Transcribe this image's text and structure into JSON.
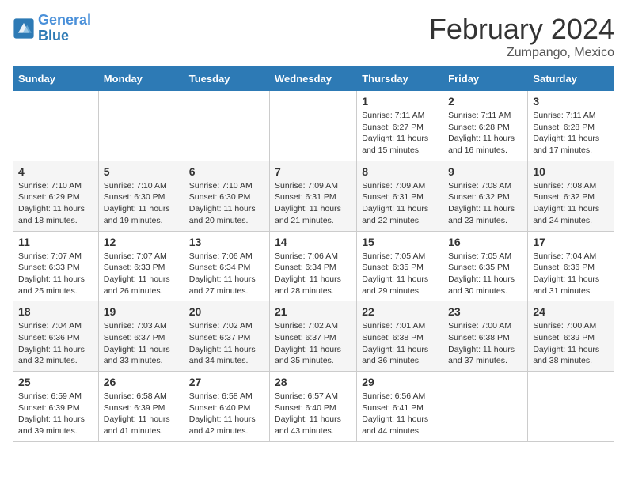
{
  "header": {
    "logo_line1": "General",
    "logo_line2": "Blue",
    "title": "February 2024",
    "subtitle": "Zumpango, Mexico"
  },
  "weekdays": [
    "Sunday",
    "Monday",
    "Tuesday",
    "Wednesday",
    "Thursday",
    "Friday",
    "Saturday"
  ],
  "weeks": [
    [
      {
        "day": "",
        "info": ""
      },
      {
        "day": "",
        "info": ""
      },
      {
        "day": "",
        "info": ""
      },
      {
        "day": "",
        "info": ""
      },
      {
        "day": "1",
        "info": "Sunrise: 7:11 AM\nSunset: 6:27 PM\nDaylight: 11 hours and 15 minutes."
      },
      {
        "day": "2",
        "info": "Sunrise: 7:11 AM\nSunset: 6:28 PM\nDaylight: 11 hours and 16 minutes."
      },
      {
        "day": "3",
        "info": "Sunrise: 7:11 AM\nSunset: 6:28 PM\nDaylight: 11 hours and 17 minutes."
      }
    ],
    [
      {
        "day": "4",
        "info": "Sunrise: 7:10 AM\nSunset: 6:29 PM\nDaylight: 11 hours and 18 minutes."
      },
      {
        "day": "5",
        "info": "Sunrise: 7:10 AM\nSunset: 6:30 PM\nDaylight: 11 hours and 19 minutes."
      },
      {
        "day": "6",
        "info": "Sunrise: 7:10 AM\nSunset: 6:30 PM\nDaylight: 11 hours and 20 minutes."
      },
      {
        "day": "7",
        "info": "Sunrise: 7:09 AM\nSunset: 6:31 PM\nDaylight: 11 hours and 21 minutes."
      },
      {
        "day": "8",
        "info": "Sunrise: 7:09 AM\nSunset: 6:31 PM\nDaylight: 11 hours and 22 minutes."
      },
      {
        "day": "9",
        "info": "Sunrise: 7:08 AM\nSunset: 6:32 PM\nDaylight: 11 hours and 23 minutes."
      },
      {
        "day": "10",
        "info": "Sunrise: 7:08 AM\nSunset: 6:32 PM\nDaylight: 11 hours and 24 minutes."
      }
    ],
    [
      {
        "day": "11",
        "info": "Sunrise: 7:07 AM\nSunset: 6:33 PM\nDaylight: 11 hours and 25 minutes."
      },
      {
        "day": "12",
        "info": "Sunrise: 7:07 AM\nSunset: 6:33 PM\nDaylight: 11 hours and 26 minutes."
      },
      {
        "day": "13",
        "info": "Sunrise: 7:06 AM\nSunset: 6:34 PM\nDaylight: 11 hours and 27 minutes."
      },
      {
        "day": "14",
        "info": "Sunrise: 7:06 AM\nSunset: 6:34 PM\nDaylight: 11 hours and 28 minutes."
      },
      {
        "day": "15",
        "info": "Sunrise: 7:05 AM\nSunset: 6:35 PM\nDaylight: 11 hours and 29 minutes."
      },
      {
        "day": "16",
        "info": "Sunrise: 7:05 AM\nSunset: 6:35 PM\nDaylight: 11 hours and 30 minutes."
      },
      {
        "day": "17",
        "info": "Sunrise: 7:04 AM\nSunset: 6:36 PM\nDaylight: 11 hours and 31 minutes."
      }
    ],
    [
      {
        "day": "18",
        "info": "Sunrise: 7:04 AM\nSunset: 6:36 PM\nDaylight: 11 hours and 32 minutes."
      },
      {
        "day": "19",
        "info": "Sunrise: 7:03 AM\nSunset: 6:37 PM\nDaylight: 11 hours and 33 minutes."
      },
      {
        "day": "20",
        "info": "Sunrise: 7:02 AM\nSunset: 6:37 PM\nDaylight: 11 hours and 34 minutes."
      },
      {
        "day": "21",
        "info": "Sunrise: 7:02 AM\nSunset: 6:37 PM\nDaylight: 11 hours and 35 minutes."
      },
      {
        "day": "22",
        "info": "Sunrise: 7:01 AM\nSunset: 6:38 PM\nDaylight: 11 hours and 36 minutes."
      },
      {
        "day": "23",
        "info": "Sunrise: 7:00 AM\nSunset: 6:38 PM\nDaylight: 11 hours and 37 minutes."
      },
      {
        "day": "24",
        "info": "Sunrise: 7:00 AM\nSunset: 6:39 PM\nDaylight: 11 hours and 38 minutes."
      }
    ],
    [
      {
        "day": "25",
        "info": "Sunrise: 6:59 AM\nSunset: 6:39 PM\nDaylight: 11 hours and 39 minutes."
      },
      {
        "day": "26",
        "info": "Sunrise: 6:58 AM\nSunset: 6:39 PM\nDaylight: 11 hours and 41 minutes."
      },
      {
        "day": "27",
        "info": "Sunrise: 6:58 AM\nSunset: 6:40 PM\nDaylight: 11 hours and 42 minutes."
      },
      {
        "day": "28",
        "info": "Sunrise: 6:57 AM\nSunset: 6:40 PM\nDaylight: 11 hours and 43 minutes."
      },
      {
        "day": "29",
        "info": "Sunrise: 6:56 AM\nSunset: 6:41 PM\nDaylight: 11 hours and 44 minutes."
      },
      {
        "day": "",
        "info": ""
      },
      {
        "day": "",
        "info": ""
      }
    ]
  ]
}
